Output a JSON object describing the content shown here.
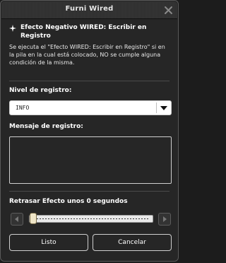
{
  "window": {
    "title": "Furni Wired"
  },
  "effect": {
    "title": "Efecto Negativo WIRED: Escribir en Registro",
    "description": "Se ejecuta el \"Efecto WIRED: Escribir en Registro\" si en la pila en la cual está colocado, NO se cumple alguna condición de la misma."
  },
  "log_level": {
    "label": "Nivel de registro:",
    "selected": "INFO"
  },
  "log_message": {
    "label": "Mensaje de registro:",
    "value": ""
  },
  "delay": {
    "label": "Retrasar Efecto unos 0 segundos",
    "value": 0
  },
  "buttons": {
    "ok": "Listo",
    "cancel": "Cancelar"
  },
  "icons": {
    "close": "close-icon",
    "star": "sparkle-icon",
    "dropdown": "chevron-down-icon",
    "left": "arrow-left-icon",
    "right": "arrow-right-icon"
  }
}
